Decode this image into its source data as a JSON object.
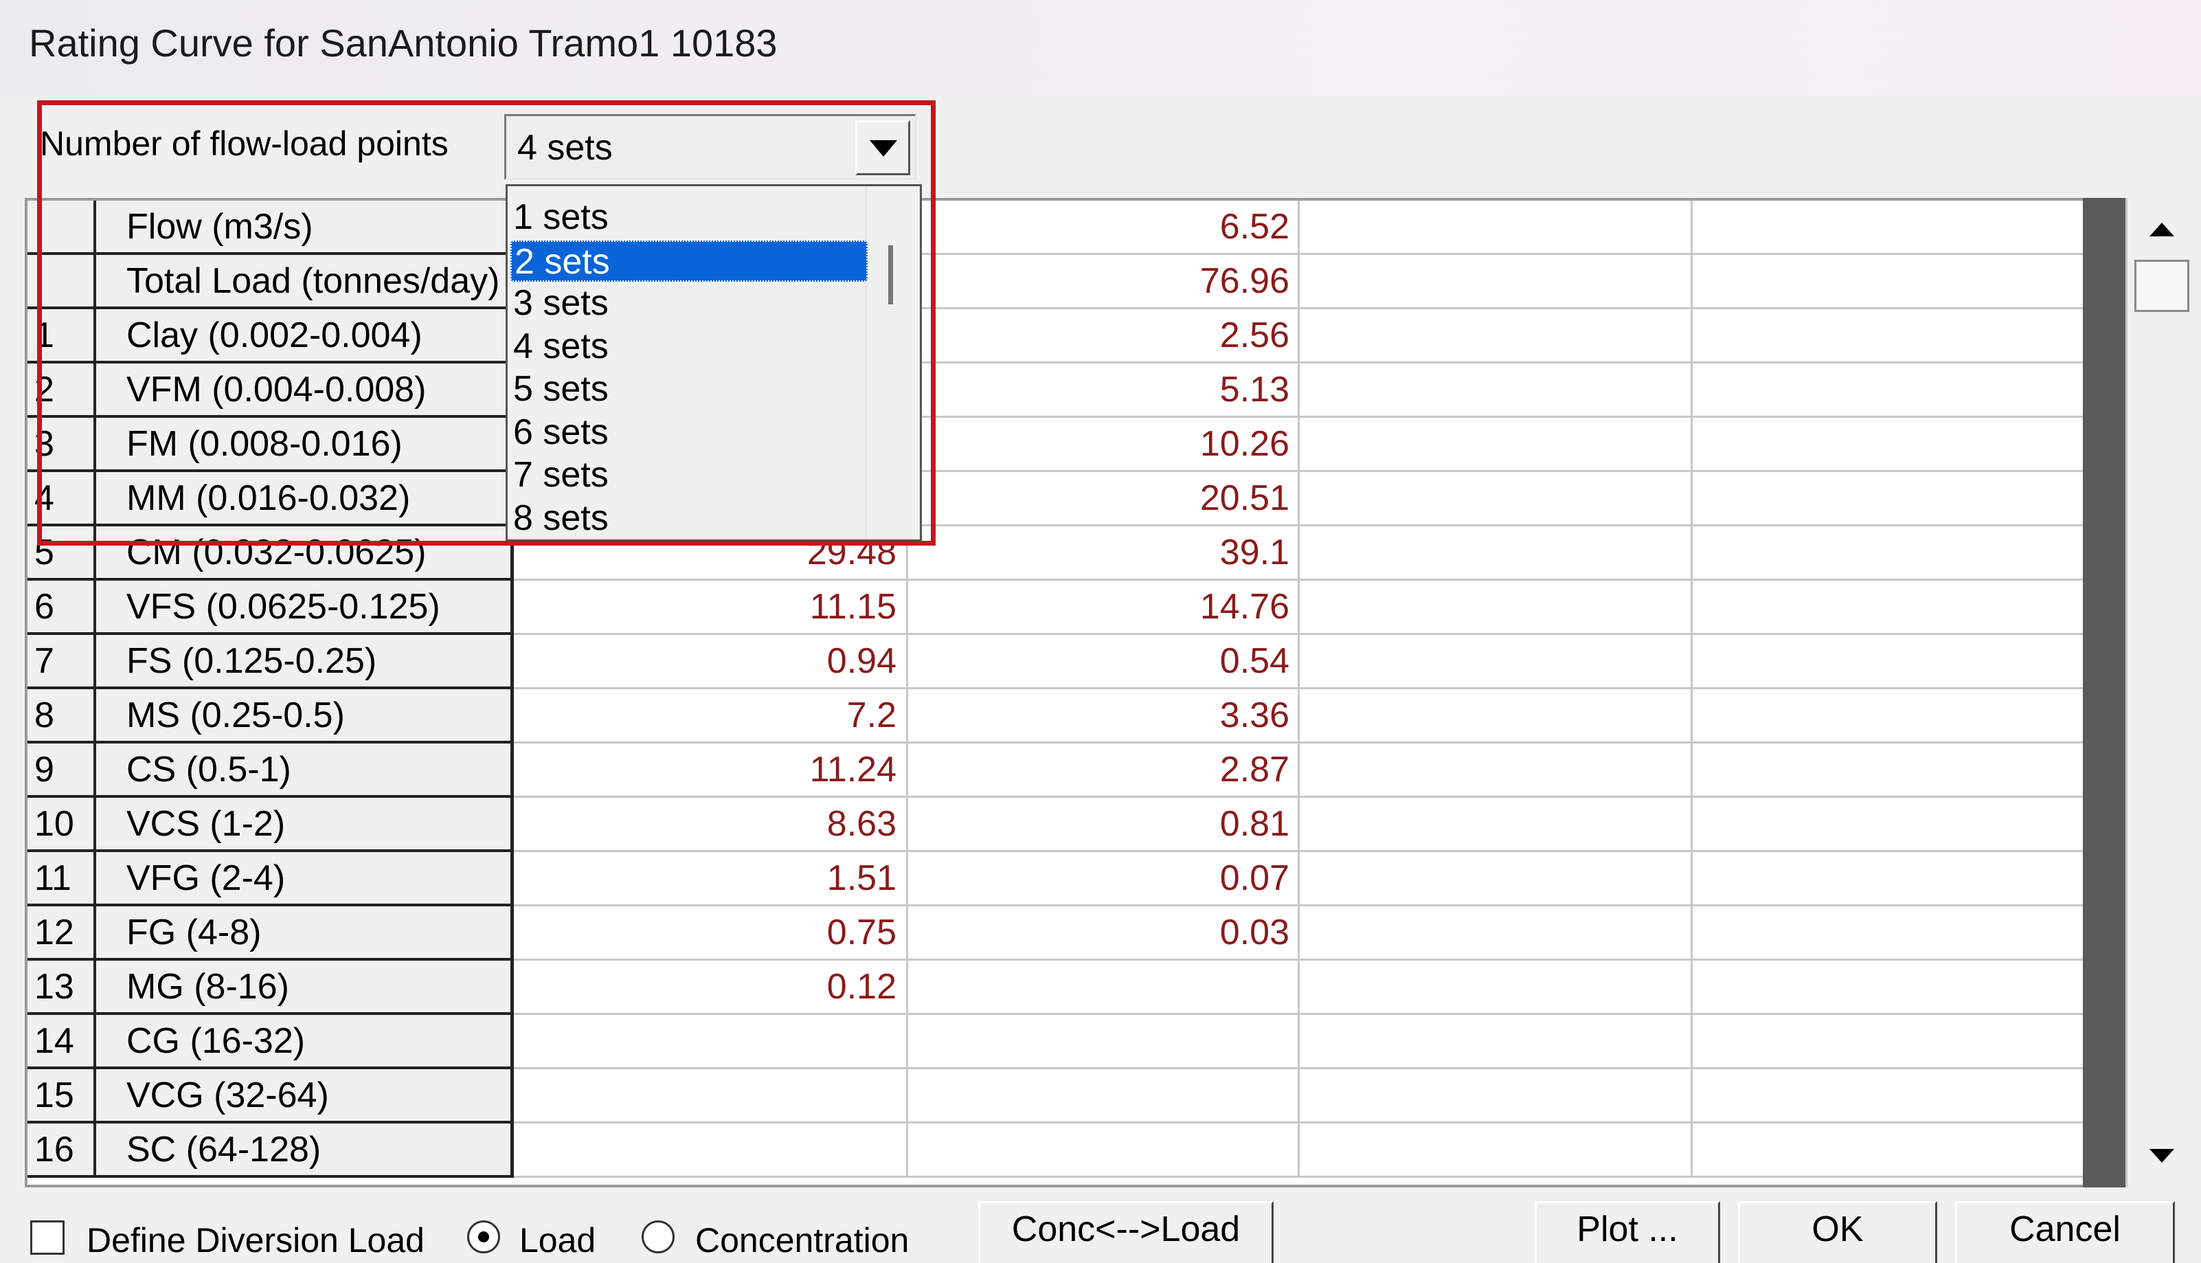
{
  "window": {
    "title": "Rating Curve for SanAntonio Tramo1 10183"
  },
  "flow_points": {
    "label": "Number of flow-load points",
    "selected": "4 sets",
    "options": [
      "1 sets",
      "2 sets",
      "3 sets",
      "4 sets",
      "5 sets",
      "6 sets",
      "7 sets",
      "8 sets"
    ],
    "highlighted_option": "2 sets"
  },
  "grid": {
    "rows": [
      {
        "idx": "",
        "name": "Flow (m3/s)",
        "v1": "",
        "v2": "6.52",
        "v3": "",
        "v4": ""
      },
      {
        "idx": "",
        "name": "Total Load (tonnes/day)",
        "v1": "",
        "v2": "76.96",
        "v3": "",
        "v4": ""
      },
      {
        "idx": "1",
        "name": "Clay (0.002-0.004)",
        "v1": "",
        "v2": "2.56",
        "v3": "",
        "v4": ""
      },
      {
        "idx": "2",
        "name": "VFM (0.004-0.008)",
        "v1": "",
        "v2": "5.13",
        "v3": "",
        "v4": ""
      },
      {
        "idx": "3",
        "name": "FM (0.008-0.016)",
        "v1": "",
        "v2": "10.26",
        "v3": "",
        "v4": ""
      },
      {
        "idx": "4",
        "name": "MM (0.016-0.032)",
        "v1": "",
        "v2": "20.51",
        "v3": "",
        "v4": ""
      },
      {
        "idx": "5",
        "name": "CM (0.032-0.0625)",
        "v1": "29.48",
        "v2": "39.1",
        "v3": "",
        "v4": ""
      },
      {
        "idx": "6",
        "name": "VFS (0.0625-0.125)",
        "v1": "11.15",
        "v2": "14.76",
        "v3": "",
        "v4": ""
      },
      {
        "idx": "7",
        "name": "FS (0.125-0.25)",
        "v1": "0.94",
        "v2": "0.54",
        "v3": "",
        "v4": ""
      },
      {
        "idx": "8",
        "name": "MS (0.25-0.5)",
        "v1": "7.2",
        "v2": "3.36",
        "v3": "",
        "v4": ""
      },
      {
        "idx": "9",
        "name": "CS (0.5-1)",
        "v1": "11.24",
        "v2": "2.87",
        "v3": "",
        "v4": ""
      },
      {
        "idx": "10",
        "name": "VCS (1-2)",
        "v1": "8.63",
        "v2": "0.81",
        "v3": "",
        "v4": ""
      },
      {
        "idx": "11",
        "name": "VFG (2-4)",
        "v1": "1.51",
        "v2": "0.07",
        "v3": "",
        "v4": ""
      },
      {
        "idx": "12",
        "name": "FG (4-8)",
        "v1": "0.75",
        "v2": "0.03",
        "v3": "",
        "v4": ""
      },
      {
        "idx": "13",
        "name": "MG (8-16)",
        "v1": "0.12",
        "v2": "",
        "v3": "",
        "v4": ""
      },
      {
        "idx": "14",
        "name": "CG (16-32)",
        "v1": "",
        "v2": "",
        "v3": "",
        "v4": ""
      },
      {
        "idx": "15",
        "name": "VCG (32-64)",
        "v1": "",
        "v2": "",
        "v3": "",
        "v4": ""
      },
      {
        "idx": "16",
        "name": "SC (64-128)",
        "v1": "",
        "v2": "",
        "v3": "",
        "v4": ""
      }
    ]
  },
  "bottom": {
    "define_diversion_label": "Define Diversion Load",
    "define_diversion_checked": false,
    "load_label": "Load",
    "load_selected": true,
    "concentration_label": "Concentration",
    "conc_load_button": "Conc<-->Load",
    "plot_button": "Plot ...",
    "ok_button": "OK",
    "cancel_button": "Cancel"
  },
  "colors": {
    "value_text": "#8b1a1a",
    "selection": "#0a64d8",
    "highlight_box": "#c8141e"
  }
}
